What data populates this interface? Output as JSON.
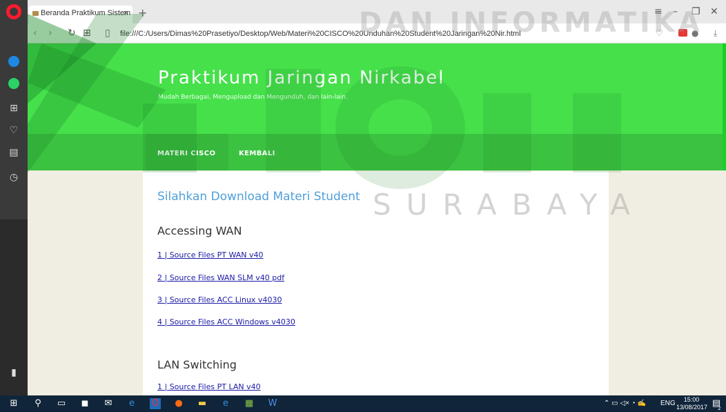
{
  "browser": {
    "tab_title": "Beranda Praktikum Sistem",
    "tab_close": "×",
    "new_tab": "+",
    "url": "file:///C:/Users/Dimas%20Prasetiyo/Desktop/Web/Materi%20CISCO%20Unduhan%20Student%20Jaringan%20Nir.html"
  },
  "site": {
    "title": "Praktikum Jaringan Nirkabel",
    "tagline": "Mudah Berbagai, Mengupload dan Mengunduh, dan lain-lain.",
    "menu": [
      {
        "label": "MATERI CISCO",
        "active": true
      },
      {
        "label": "KEMBALI",
        "active": false
      }
    ]
  },
  "content": {
    "heading": "Silahkan Download Materi Student",
    "sections": [
      {
        "title": "Accessing WAN",
        "links": [
          "1 | Source Files PT WAN v40",
          "2 | Source Files WAN SLM v40 pdf",
          "3 | Source Files ACC Linux v4030",
          "4 | Source Files ACC Windows v4030"
        ]
      },
      {
        "title": "LAN Switching",
        "links": [
          "1 | Source Files PT LAN v40"
        ]
      }
    ]
  },
  "watermark": {
    "line1": "DAN INFORMATIKA",
    "line2": "SURABAYA"
  },
  "taskbar": {
    "lang": "ENG",
    "time": "15:00",
    "date": "13/08/2017",
    "notifications": "2"
  },
  "colors": {
    "hero_green": "#46e04b",
    "nav_green": "#3cc241",
    "link_blue": "#1a1aa6",
    "heading_blue": "#4f9fd9"
  }
}
